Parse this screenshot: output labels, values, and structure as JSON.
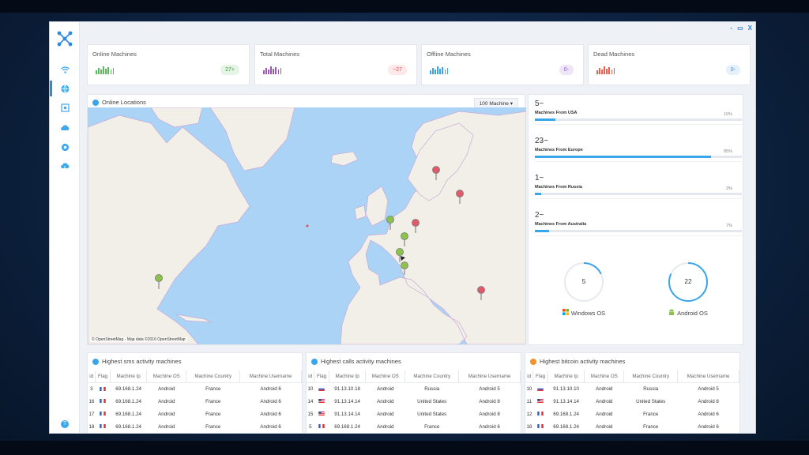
{
  "window_controls": {
    "minimize": "-",
    "maximize": "▭",
    "close": "X"
  },
  "sidebar": {
    "items": [
      {
        "icon": "wifi-icon"
      },
      {
        "icon": "globe-icon",
        "active": true
      },
      {
        "icon": "target-icon"
      },
      {
        "icon": "cloud-icon"
      },
      {
        "icon": "settings-icon"
      },
      {
        "icon": "download-icon"
      }
    ],
    "help": "?"
  },
  "stats": [
    {
      "title": "Online Machines",
      "value": "27+",
      "color": "#5cb85c",
      "badge_bg": "#e5f4e4",
      "badge_color": "#3f9a3f",
      "bars": [
        0.5,
        0.8,
        0.6,
        1,
        0.7,
        0.9,
        0.6,
        0.8
      ]
    },
    {
      "title": "Total Machines",
      "value": "~27",
      "color": "#9b59b6",
      "badge_bg": "#fde8ea",
      "badge_color": "#d9534f",
      "bars": [
        0.5,
        0.8,
        0.6,
        1,
        0.7,
        0.9,
        0.6,
        0.8
      ]
    },
    {
      "title": "Offline Machines",
      "value": "0-",
      "color": "#3aa6ea",
      "badge_bg": "#eee6f7",
      "badge_color": "#8e5bc0",
      "bars": [
        0.5,
        0.8,
        0.6,
        1,
        0.7,
        0.9,
        0.6,
        0.8
      ]
    },
    {
      "title": "Dead Machines",
      "value": "0-",
      "color": "#e9604d",
      "badge_bg": "#e4f1fb",
      "badge_color": "#3a8fd0",
      "bars": [
        0.5,
        0.8,
        0.6,
        1,
        0.7,
        0.9,
        0.6,
        0.8
      ]
    }
  ],
  "map_panel": {
    "title": "Online Locations",
    "select_value": "100 Machine",
    "attribution": "© OpenStreetMap - Map data ©2016 OpenStreetMap"
  },
  "regions": [
    {
      "value": "5~",
      "label": "Machines From USA",
      "percent": "10%",
      "fraction": 0.1
    },
    {
      "value": "23~",
      "label": "Machines From Europe",
      "percent": "85%",
      "fraction": 0.85
    },
    {
      "value": "1~",
      "label": "Machines From Russia",
      "percent": "3%",
      "fraction": 0.03
    },
    {
      "value": "2~",
      "label": "Machines From Australia",
      "percent": "7%",
      "fraction": 0.07
    }
  ],
  "os": [
    {
      "count": "5",
      "label": "Windows OS",
      "icon": "windows-icon",
      "fraction": 0.18
    },
    {
      "count": "22",
      "label": "Android OS",
      "icon": "android-icon",
      "fraction": 0.82
    }
  ],
  "tables": [
    {
      "title": "Highest sms activity machines",
      "icon": "sms-icon",
      "icon_color": "#3aa6ea",
      "headers": [
        "id",
        "Flag",
        "Machine Ip",
        "Machine OS",
        "Machine Country",
        "Machine Username"
      ],
      "rows": [
        [
          "3",
          "fr",
          "69.168.1.24",
          "Android",
          "France",
          "Android 6"
        ],
        [
          "16",
          "fr",
          "69.168.1.24",
          "Android",
          "France",
          "Android 6"
        ],
        [
          "17",
          "fr",
          "69.168.1.24",
          "Android",
          "France",
          "Android 6"
        ],
        [
          "18",
          "fr",
          "69.168.1.24",
          "Android",
          "France",
          "Android 6"
        ]
      ]
    },
    {
      "title": "Highest calls activity machines",
      "icon": "phone-icon",
      "icon_color": "#3aa6ea",
      "headers": [
        "id",
        "Flag",
        "Machine Ip",
        "Machine OS",
        "Machine Country",
        "Machine Username"
      ],
      "rows": [
        [
          "10",
          "ru",
          "91.13.10.18",
          "Android",
          "Russia",
          "Android 5"
        ],
        [
          "14",
          "us",
          "91.13.14.14",
          "Android",
          "United States",
          "Android 8"
        ],
        [
          "15",
          "us",
          "91.13.14.14",
          "Android",
          "United States",
          "Android 8"
        ],
        [
          "5",
          "fr",
          "69.168.1.24",
          "Android",
          "France",
          "Android 6"
        ]
      ]
    },
    {
      "title": "Highest bitcoin activity machines",
      "icon": "bitcoin-icon",
      "icon_color": "#f0932b",
      "headers": [
        "id",
        "Flag",
        "Machine Ip",
        "Machine OS",
        "Machine Country",
        "Machine Username"
      ],
      "rows": [
        [
          "10",
          "ru",
          "91.13.10.10",
          "Android",
          "Russia",
          "Android 5"
        ],
        [
          "11",
          "us",
          "91.13.14.14",
          "Android",
          "United States",
          "Android 8"
        ],
        [
          "12",
          "fr",
          "69.168.1.24",
          "Android",
          "France",
          "Android 6"
        ],
        [
          "18",
          "fr",
          "69.168.1.24",
          "Android",
          "France",
          "Android 6"
        ]
      ]
    }
  ]
}
